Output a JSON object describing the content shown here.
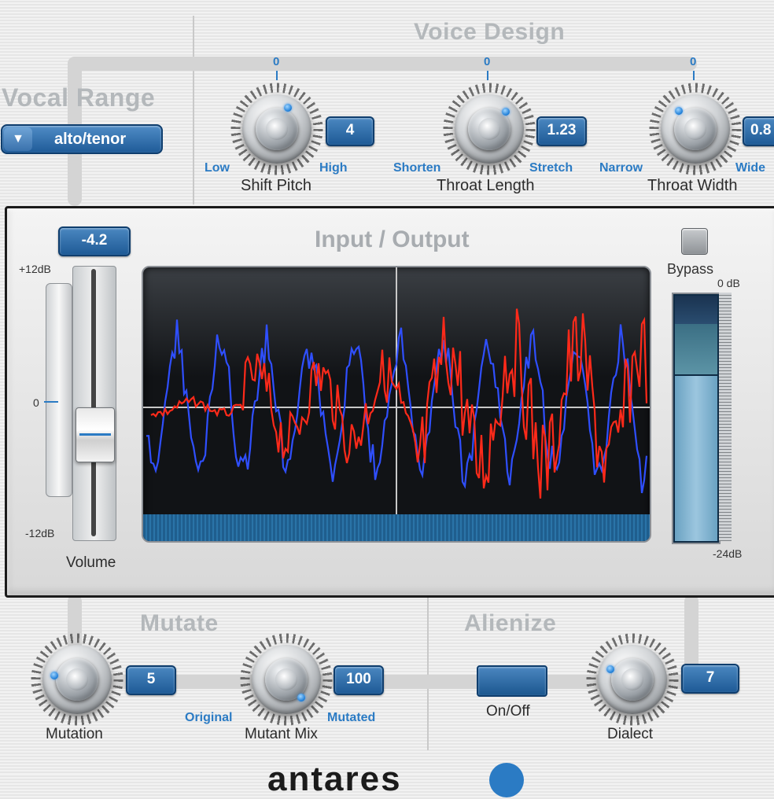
{
  "voice_design": {
    "title": "Voice Design",
    "shift_pitch": {
      "label": "Shift Pitch",
      "value": "4",
      "zero": "0",
      "min_label": "Low",
      "max_label": "High"
    },
    "throat_length": {
      "label": "Throat Length",
      "value": "1.23",
      "zero": "0",
      "min_label": "Shorten",
      "max_label": "Stretch"
    },
    "throat_width": {
      "label": "Throat Width",
      "value": "0.8",
      "zero": "0",
      "min_label": "Narrow",
      "max_label": "Wide"
    }
  },
  "vocal_range": {
    "title": "Vocal Range",
    "selected": "alto/tenor"
  },
  "io": {
    "title": "Input / Output",
    "volume_value": "-4.2",
    "volume_label": "Volume",
    "scale_top": "+12dB",
    "scale_mid": "0",
    "scale_bottom": "-12dB",
    "bypass_label": "Bypass",
    "out_top": "0 dB",
    "out_bottom": "-24dB"
  },
  "mutate": {
    "title": "Mutate",
    "mutation": {
      "label": "Mutation",
      "value": "5"
    },
    "mutant_mix": {
      "label": "Mutant Mix",
      "value": "100",
      "min_label": "Original",
      "max_label": "Mutated"
    }
  },
  "alienize": {
    "title": "Alienize",
    "onoff_label": "On/Off",
    "dialect": {
      "label": "Dialect",
      "value": "7"
    }
  },
  "brand": {
    "logo_text": "antares"
  },
  "colors": {
    "accent_blue": "#2b7bc4",
    "wave_blue": "#2f4fff",
    "wave_red": "#ff2a1a"
  }
}
